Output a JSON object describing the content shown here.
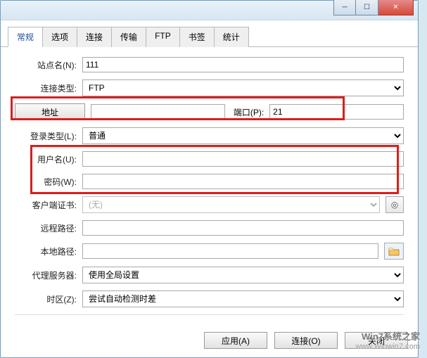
{
  "window": {
    "title": ""
  },
  "tabs": [
    "常规",
    "选项",
    "连接",
    "传输",
    "FTP",
    "书签",
    "统计"
  ],
  "active_tab": 0,
  "labels": {
    "site_name": "站点名(N):",
    "conn_type": "连接类型:",
    "address_btn": "地址",
    "port": "端口(P):",
    "login_type": "登录类型(L):",
    "user": "用户名(U):",
    "password": "密码(W):",
    "client_cert": "客户端证书:",
    "remote_path": "远程路径:",
    "local_path": "本地路径:",
    "proxy": "代理服务器:",
    "timezone": "时区(Z):"
  },
  "values": {
    "site_name": "111",
    "conn_type": "FTP",
    "address": "",
    "port": "21",
    "login_type": "普通",
    "user": "",
    "password": "",
    "client_cert": "(无)",
    "remote_path": "",
    "local_path": "",
    "proxy": "使用全局设置",
    "timezone": "尝试自动检测时差"
  },
  "buttons": {
    "apply": "应用(A)",
    "connect": "连接(O)",
    "close": "关闭"
  },
  "watermark": {
    "line1": "Win7系统之家",
    "line2": "www.Winwin7.com"
  }
}
